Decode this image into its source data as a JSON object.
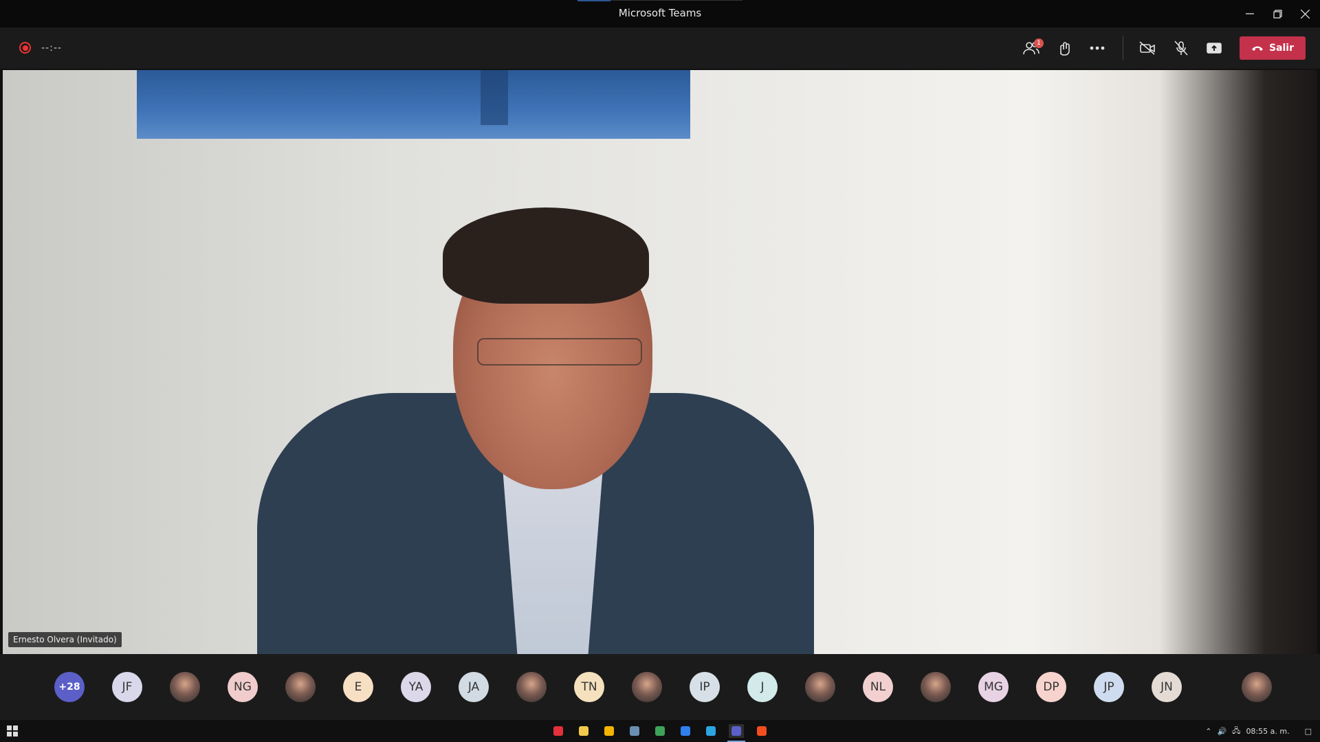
{
  "window": {
    "title": "Microsoft Teams"
  },
  "toolbar": {
    "timer": "--:--",
    "participants_badge": "1",
    "leave_label": "Salir"
  },
  "video": {
    "speaker_name": "Ernesto Olvera (Invitado)"
  },
  "participants": [
    {
      "type": "more",
      "label": "+28"
    },
    {
      "type": "initials",
      "label": "JF",
      "color": "#d8d8ea"
    },
    {
      "type": "photo",
      "label": ""
    },
    {
      "type": "initials",
      "label": "NG",
      "color": "#f0cccc"
    },
    {
      "type": "photo",
      "label": ""
    },
    {
      "type": "initials",
      "label": "E",
      "color": "#f7dfc4"
    },
    {
      "type": "initials",
      "label": "YA",
      "color": "#dcd8ea"
    },
    {
      "type": "initials",
      "label": "JA",
      "color": "#d2dbe3"
    },
    {
      "type": "photo",
      "label": ""
    },
    {
      "type": "initials",
      "label": "TN",
      "color": "#f5e1bd"
    },
    {
      "type": "photo",
      "label": ""
    },
    {
      "type": "initials",
      "label": "IP",
      "color": "#d6e0e6"
    },
    {
      "type": "initials",
      "label": "J",
      "color": "#d2eaea"
    },
    {
      "type": "photo",
      "label": ""
    },
    {
      "type": "initials",
      "label": "NL",
      "color": "#f3d0d0"
    },
    {
      "type": "photo",
      "label": ""
    },
    {
      "type": "initials",
      "label": "MG",
      "color": "#e8d3e4"
    },
    {
      "type": "initials",
      "label": "DP",
      "color": "#f6d3cd"
    },
    {
      "type": "initials",
      "label": "JP",
      "color": "#cfdcef"
    },
    {
      "type": "initials",
      "label": "JN",
      "color": "#e4dcd4"
    }
  ],
  "self_view": {
    "type": "photo"
  },
  "taskbar": {
    "clock": "08:55 a. m.",
    "icons": [
      "opera-icon",
      "file-explorer-icon",
      "chrome-icon",
      "network-icon",
      "steam-icon",
      "photos-icon",
      "telegram-icon",
      "teams-icon",
      "figma-icon"
    ]
  }
}
